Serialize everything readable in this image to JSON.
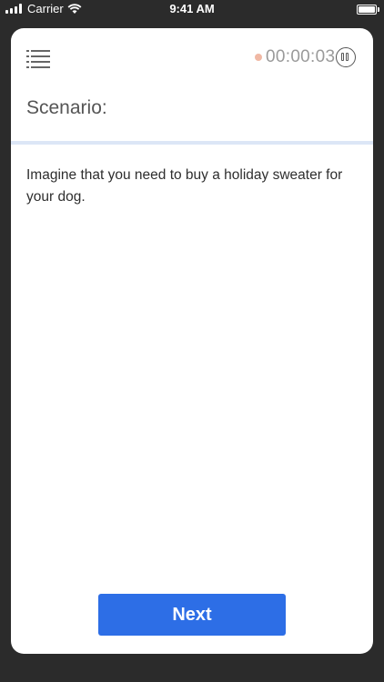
{
  "status_bar": {
    "carrier": "Carrier",
    "time": "9:41 AM",
    "icons": [
      "signal-icon",
      "wifi-icon",
      "battery-icon"
    ]
  },
  "header": {
    "menu_icon": "list-menu-icon",
    "timer": "00:00:03",
    "recording_color": "#f0b8a4",
    "pause_icon": "pause-icon"
  },
  "scenario": {
    "label": "Scenario:",
    "text": "Imagine that you need to buy a holiday sweater for your dog."
  },
  "footer": {
    "next_label": "Next",
    "accent_color": "#2d6ee6"
  }
}
